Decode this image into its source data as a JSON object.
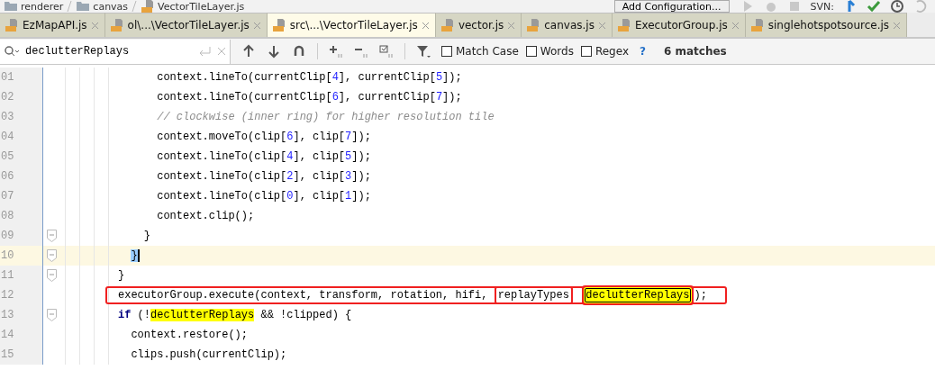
{
  "breadcrumb": [
    {
      "label": "renderer",
      "kind": "folder"
    },
    {
      "label": "canvas",
      "kind": "folder"
    },
    {
      "label": "VectorTileLayer.js",
      "kind": "file"
    }
  ],
  "toolbar": {
    "config_button": "Add Configuration...",
    "vcs_label": "SVN:"
  },
  "tabs": [
    {
      "label": "EzMapAPI.js",
      "selected": false
    },
    {
      "label": "ol\\...\\VectorTileLayer.js",
      "selected": false
    },
    {
      "label": "src\\...\\VectorTileLayer.js",
      "selected": true
    },
    {
      "label": "vector.js",
      "selected": false
    },
    {
      "label": "canvas.js",
      "selected": false
    },
    {
      "label": "ExecutorGroup.js",
      "selected": false
    },
    {
      "label": "singlehotspotsource.js",
      "selected": false
    }
  ],
  "search": {
    "value": "declutterReplays",
    "options": [
      {
        "label": "Match Case",
        "checked": false
      },
      {
        "label": "Words",
        "checked": false
      },
      {
        "label": "Regex",
        "checked": false
      }
    ],
    "help": "?",
    "matches": "6 matches"
  },
  "editor": {
    "lines": [
      {
        "number": "01",
        "fold": false,
        "current": false,
        "outlined": false,
        "tokens": [
          {
            "text": "      context.lineTo(currentClip[",
            "kind": "plain"
          },
          {
            "text": "4",
            "kind": "number"
          },
          {
            "text": "], currentClip[",
            "kind": "plain"
          },
          {
            "text": "5",
            "kind": "number"
          },
          {
            "text": "]);",
            "kind": "plain"
          }
        ]
      },
      {
        "number": "02",
        "fold": false,
        "current": false,
        "outlined": false,
        "tokens": [
          {
            "text": "      context.lineTo(currentClip[",
            "kind": "plain"
          },
          {
            "text": "6",
            "kind": "number"
          },
          {
            "text": "], currentClip[",
            "kind": "plain"
          },
          {
            "text": "7",
            "kind": "number"
          },
          {
            "text": "]);",
            "kind": "plain"
          }
        ]
      },
      {
        "number": "03",
        "fold": false,
        "current": false,
        "outlined": false,
        "tokens": [
          {
            "text": "      // clockwise (inner ring) for higher resolution tile",
            "kind": "comment"
          }
        ]
      },
      {
        "number": "04",
        "fold": false,
        "current": false,
        "outlined": false,
        "tokens": [
          {
            "text": "      context.moveTo(clip[",
            "kind": "plain"
          },
          {
            "text": "6",
            "kind": "number"
          },
          {
            "text": "], clip[",
            "kind": "plain"
          },
          {
            "text": "7",
            "kind": "number"
          },
          {
            "text": "]);",
            "kind": "plain"
          }
        ]
      },
      {
        "number": "05",
        "fold": false,
        "current": false,
        "outlined": false,
        "tokens": [
          {
            "text": "      context.lineTo(clip[",
            "kind": "plain"
          },
          {
            "text": "4",
            "kind": "number"
          },
          {
            "text": "], clip[",
            "kind": "plain"
          },
          {
            "text": "5",
            "kind": "number"
          },
          {
            "text": "]);",
            "kind": "plain"
          }
        ]
      },
      {
        "number": "06",
        "fold": false,
        "current": false,
        "outlined": false,
        "tokens": [
          {
            "text": "      context.lineTo(clip[",
            "kind": "plain"
          },
          {
            "text": "2",
            "kind": "number"
          },
          {
            "text": "], clip[",
            "kind": "plain"
          },
          {
            "text": "3",
            "kind": "number"
          },
          {
            "text": "]);",
            "kind": "plain"
          }
        ]
      },
      {
        "number": "07",
        "fold": false,
        "current": false,
        "outlined": false,
        "tokens": [
          {
            "text": "      context.lineTo(clip[",
            "kind": "plain"
          },
          {
            "text": "0",
            "kind": "number"
          },
          {
            "text": "], clip[",
            "kind": "plain"
          },
          {
            "text": "1",
            "kind": "number"
          },
          {
            "text": "]);",
            "kind": "plain"
          }
        ]
      },
      {
        "number": "08",
        "fold": false,
        "current": false,
        "outlined": false,
        "tokens": [
          {
            "text": "      context.clip();",
            "kind": "plain"
          }
        ]
      },
      {
        "number": "09",
        "fold": true,
        "current": false,
        "outlined": false,
        "tokens": [
          {
            "text": "    }",
            "kind": "plain"
          }
        ]
      },
      {
        "number": "10",
        "fold": true,
        "current": true,
        "outlined": false,
        "tokens": [
          {
            "text": "  }",
            "kind": "brace"
          }
        ]
      },
      {
        "number": "11",
        "fold": true,
        "current": false,
        "outlined": false,
        "tokens": [
          {
            "text": "}",
            "kind": "plain"
          }
        ]
      },
      {
        "number": "12",
        "fold": false,
        "current": false,
        "outlined": true,
        "tokens": [
          {
            "text": "executorGroup.execute(context, transform, rotation, hifi, ",
            "kind": "plain"
          },
          {
            "text": "replayTypes",
            "kind": "outlined"
          },
          {
            "text": "  declutterReplays",
            "kind": "outlined-match"
          },
          {
            "text": ");",
            "kind": "plain"
          }
        ]
      },
      {
        "number": "13",
        "fold": true,
        "current": false,
        "outlined": false,
        "tokens": [
          {
            "text": "if",
            "kind": "keyword"
          },
          {
            "text": " (!",
            "kind": "plain"
          },
          {
            "text": "declutterReplays",
            "kind": "match"
          },
          {
            "text": " && !clipped) {",
            "kind": "plain"
          }
        ]
      },
      {
        "number": "14",
        "fold": false,
        "current": false,
        "outlined": false,
        "tokens": [
          {
            "text": "  context.restore();",
            "kind": "plain"
          }
        ]
      },
      {
        "number": "15",
        "fold": false,
        "current": false,
        "outlined": false,
        "tokens": [
          {
            "text": "  clips.push(currentClip);",
            "kind": "plain"
          }
        ]
      }
    ]
  }
}
